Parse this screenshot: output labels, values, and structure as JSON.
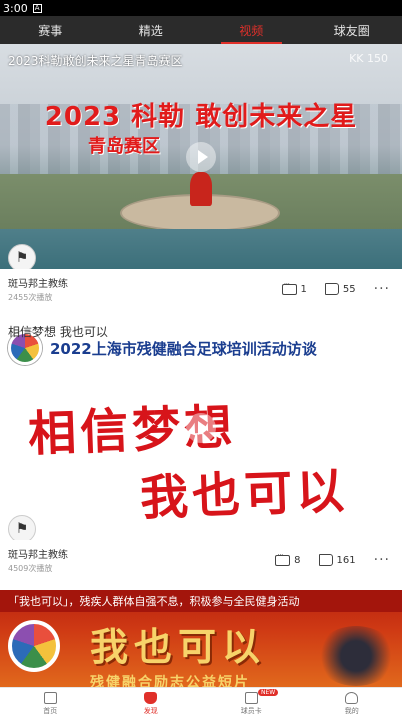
{
  "status_bar": {
    "time": "3:00",
    "indicator": "A"
  },
  "top_tabs": [
    {
      "label": "赛事",
      "active": false
    },
    {
      "label": "精选",
      "active": false
    },
    {
      "label": "视频",
      "active": true
    },
    {
      "label": "球友圈",
      "active": false
    }
  ],
  "cards": [
    {
      "title": "2023科勒敢创未来之星青岛赛区",
      "headline": "2023 科勒 敢创未来之星",
      "subheadline": "青岛赛区",
      "watermark": "KK 150",
      "author": "斑马邦主教练",
      "views": "2455次播放",
      "comments": "1",
      "likes": "55"
    },
    {
      "title": "相信梦想 我也可以",
      "banner": "2022上海市残健融合足球培训活动访谈",
      "big_line1": "相信梦想",
      "big_line2": "我也可以",
      "author": "斑马邦主教练",
      "views": "4509次播放",
      "comments": "8",
      "likes": "161"
    },
    {
      "title": "「我也可以」，残疾人群体自强不息，积极参与全民健身活动",
      "big_line1": "我也可以",
      "big_line2": "残健融合励志公益短片"
    }
  ],
  "bottom_nav": [
    {
      "label": "首页",
      "icon": "home-icon",
      "active": false
    },
    {
      "label": "发现",
      "icon": "trophy-icon",
      "active": true
    },
    {
      "label": "球员卡",
      "icon": "card-icon",
      "active": false,
      "badge": "NEW"
    },
    {
      "label": "我的",
      "icon": "user-icon",
      "active": false
    }
  ],
  "colors": {
    "accent": "#e0302a",
    "tab_bar": "#2b2b2b"
  }
}
